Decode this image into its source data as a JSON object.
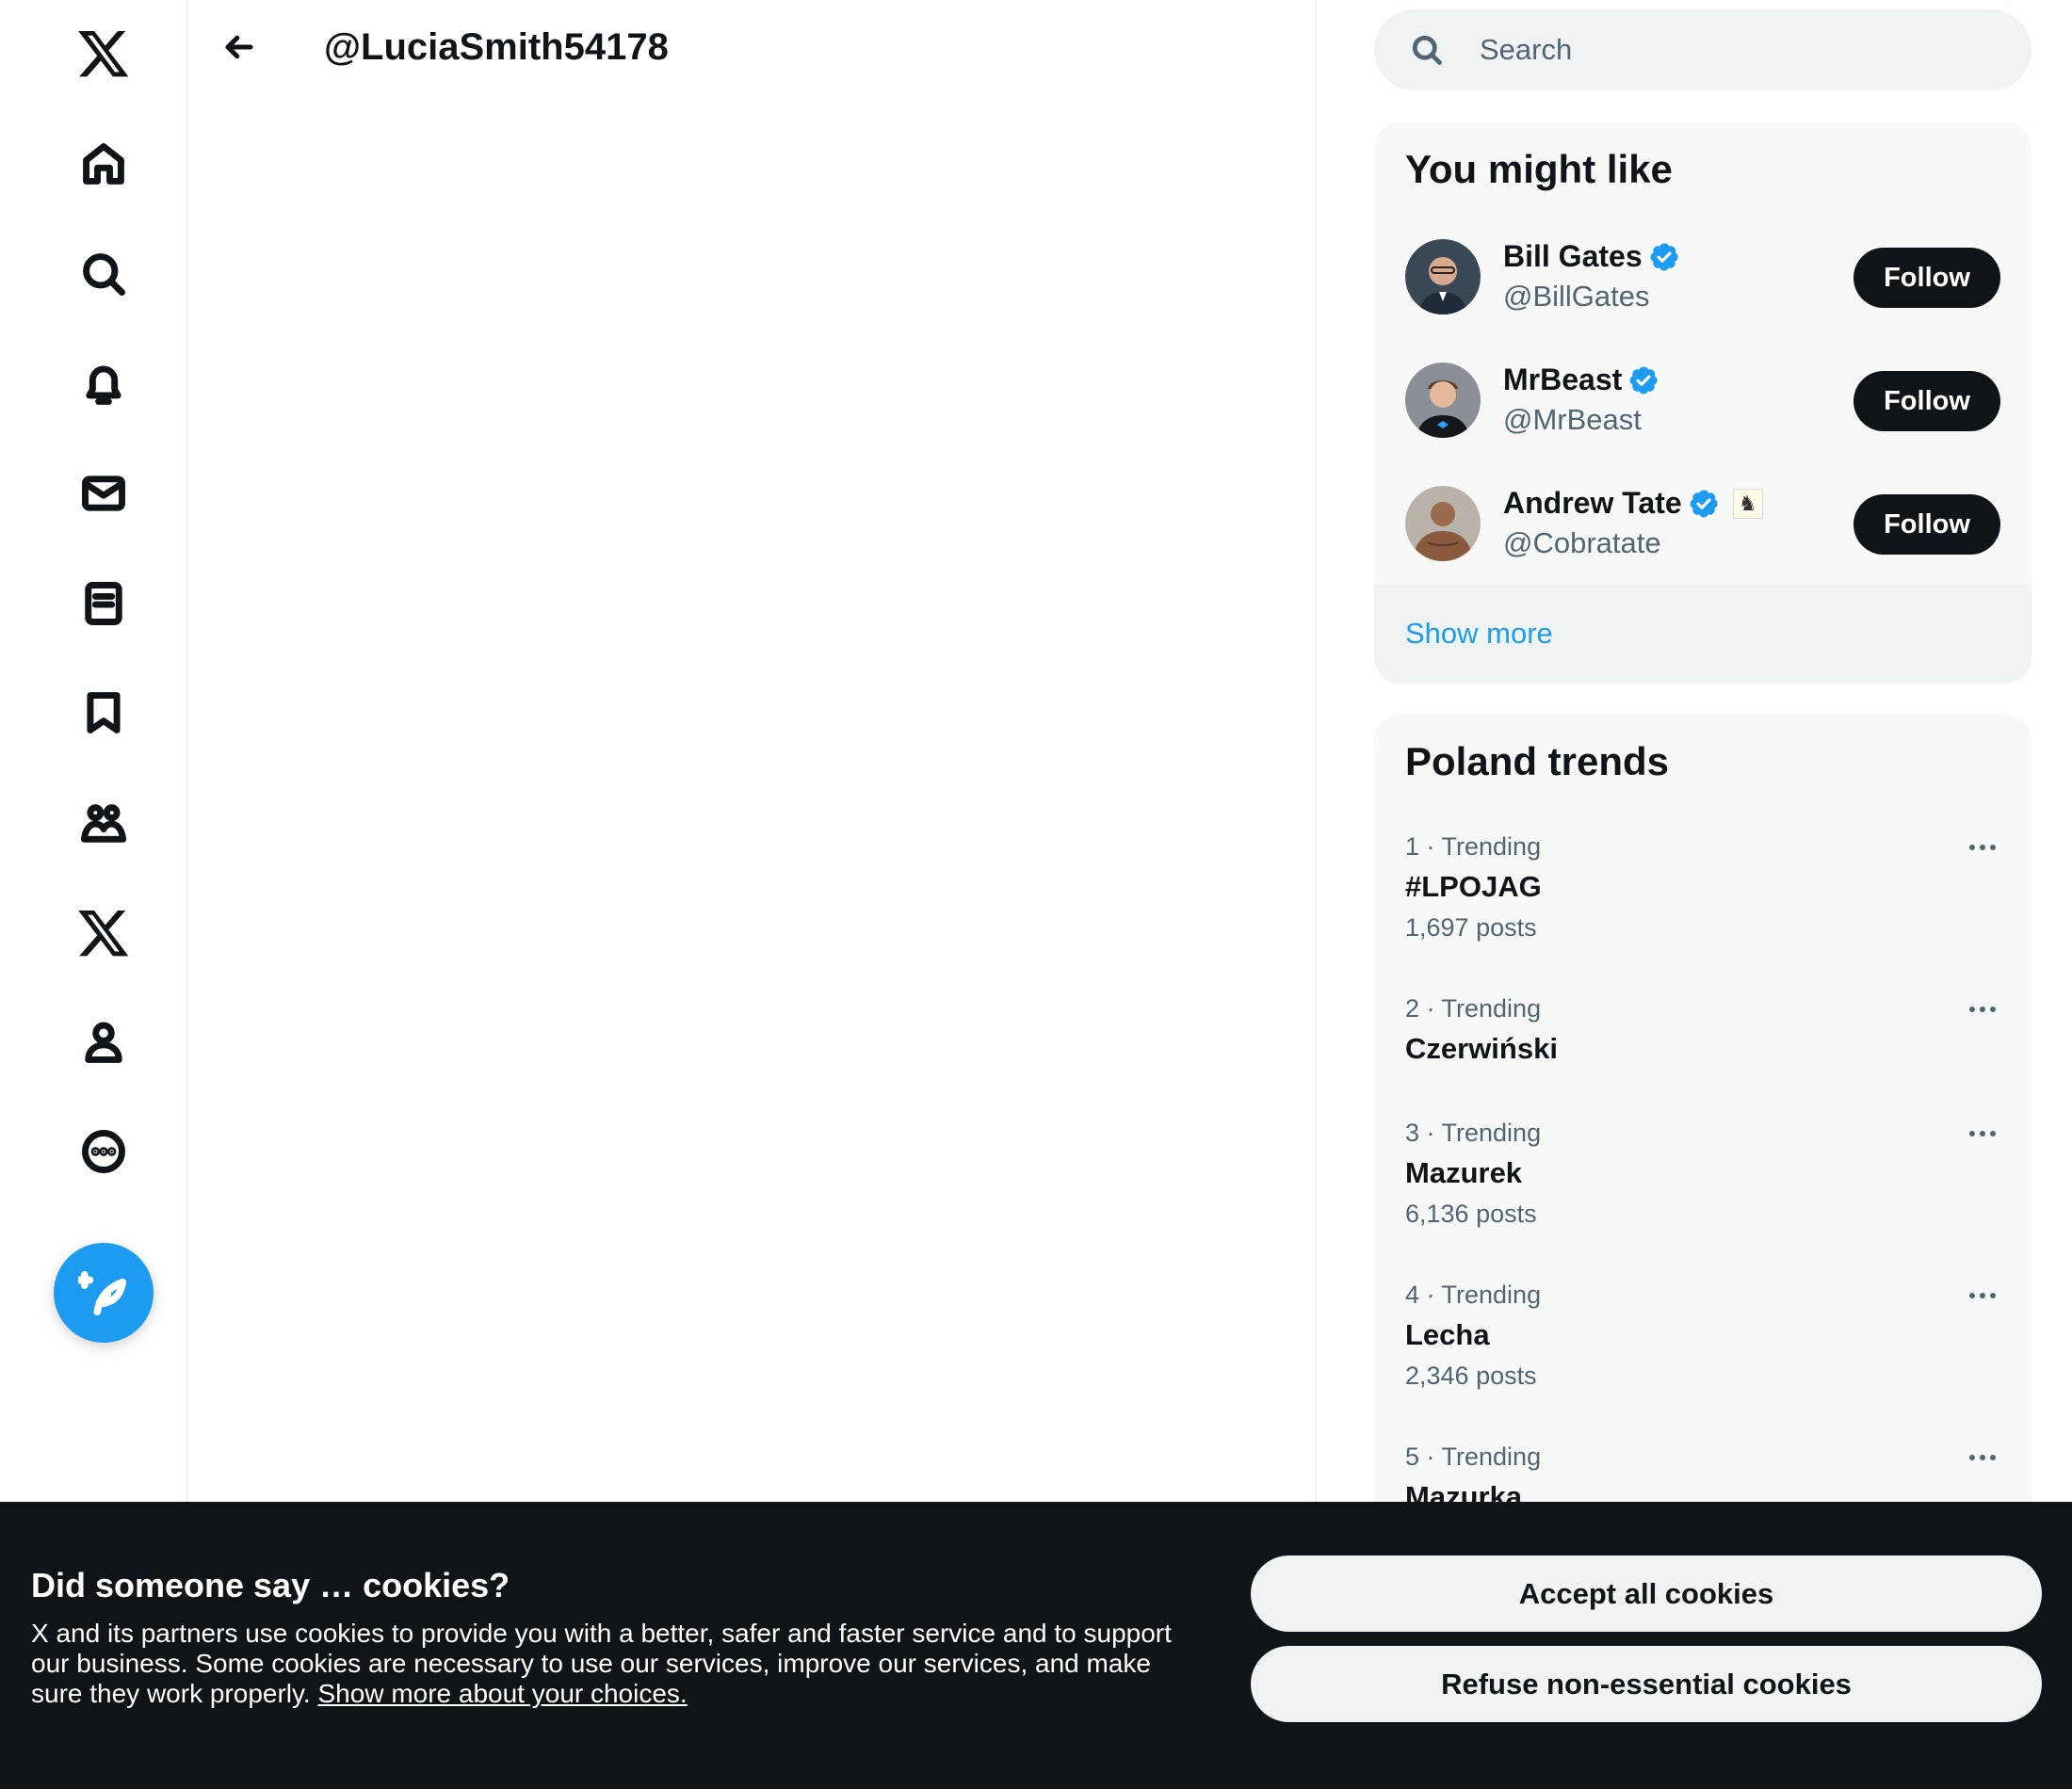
{
  "header": {
    "title": "@LuciaSmith54178"
  },
  "search": {
    "placeholder": "Search"
  },
  "who_to_follow": {
    "title": "You might like",
    "users": [
      {
        "name": "Bill Gates",
        "handle": "@BillGates",
        "verified": true,
        "follow_label": "Follow"
      },
      {
        "name": "MrBeast",
        "handle": "@MrBeast",
        "verified": true,
        "follow_label": "Follow"
      },
      {
        "name": "Andrew Tate",
        "handle": "@Cobratate",
        "verified": true,
        "follow_label": "Follow"
      }
    ],
    "show_more": "Show more"
  },
  "trends": {
    "title": "Poland trends",
    "items": [
      {
        "meta": "1 · Trending",
        "name": "#LPOJAG",
        "count": "1,697 posts"
      },
      {
        "meta": "2 · Trending",
        "name": "Czerwiński",
        "count": ""
      },
      {
        "meta": "3 · Trending",
        "name": "Mazurek",
        "count": "6,136 posts"
      },
      {
        "meta": "4 · Trending",
        "name": "Lecha",
        "count": "2,346 posts"
      },
      {
        "meta": "5 · Trending",
        "name": "Mazurka",
        "count": ""
      }
    ]
  },
  "cookie_banner": {
    "title": "Did someone say … cookies?",
    "text": "X and its partners use cookies to provide you with a better, safer and faster service and to support our business. Some cookies are necessary to use our services, improve our services, and make sure they work properly.",
    "link": "Show more about your choices.",
    "accept_label": "Accept all cookies",
    "refuse_label": "Refuse non-essential cookies"
  },
  "colors": {
    "accent": "#1d9bf0",
    "text_primary": "#0f1419",
    "text_secondary": "#536471",
    "banner_bg": "#0f1419"
  },
  "icons": {
    "nav": [
      "x-logo-icon",
      "home-icon",
      "explore-icon",
      "notifications-icon",
      "messages-icon",
      "lists-icon",
      "bookmarks-icon",
      "communities-icon",
      "premium-icon",
      "profile-icon",
      "more-icon"
    ],
    "compose": "compose-post-icon",
    "back": "back-arrow-icon",
    "search": "search-icon"
  }
}
